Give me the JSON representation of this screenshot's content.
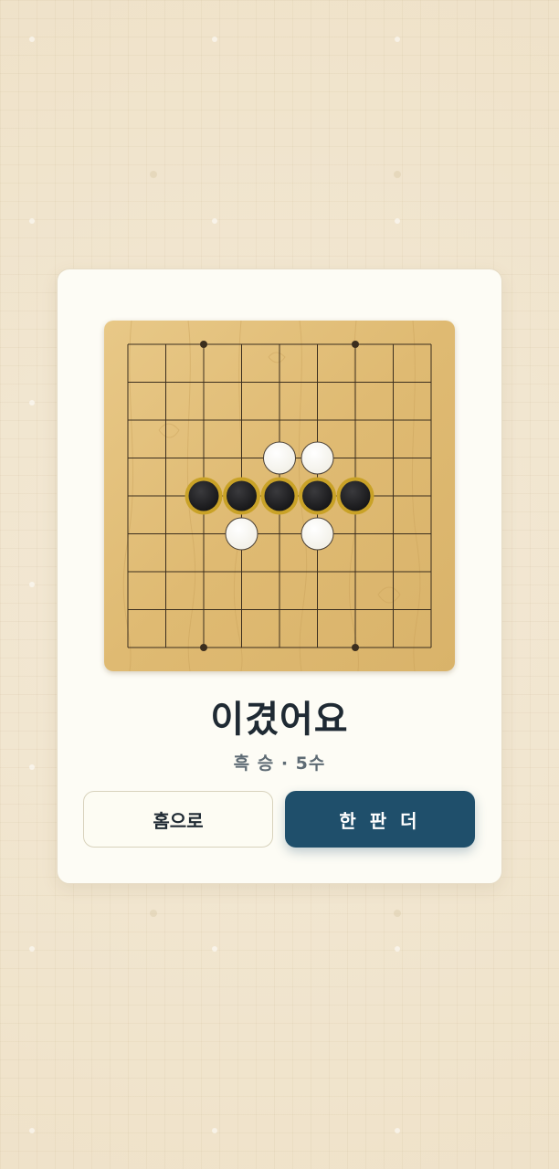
{
  "result": {
    "title": "이겼어요",
    "subtitle": "흑 승 · 5수"
  },
  "buttons": {
    "home_label": "홈으로",
    "again_label": "한 판 더"
  },
  "board": {
    "size": 9,
    "star_points": [
      [
        2,
        0
      ],
      [
        6,
        0
      ],
      [
        2,
        8
      ],
      [
        6,
        8
      ]
    ],
    "stones": [
      {
        "col": 4,
        "row": 3,
        "color": "white"
      },
      {
        "col": 5,
        "row": 3,
        "color": "white"
      },
      {
        "col": 2,
        "row": 4,
        "color": "black",
        "winning": true
      },
      {
        "col": 3,
        "row": 4,
        "color": "black",
        "winning": true
      },
      {
        "col": 4,
        "row": 4,
        "color": "black",
        "winning": true
      },
      {
        "col": 5,
        "row": 4,
        "color": "black",
        "winning": true
      },
      {
        "col": 6,
        "row": 4,
        "color": "black",
        "winning": true
      },
      {
        "col": 3,
        "row": 5,
        "color": "white"
      },
      {
        "col": 5,
        "row": 5,
        "color": "white"
      }
    ],
    "colors": {
      "wood": "#e2bf7a",
      "line": "#3b2e1e",
      "black_stone": "#1c1c1e",
      "white_stone": "#fbfaf3",
      "win_ring": "#c9a227"
    }
  }
}
